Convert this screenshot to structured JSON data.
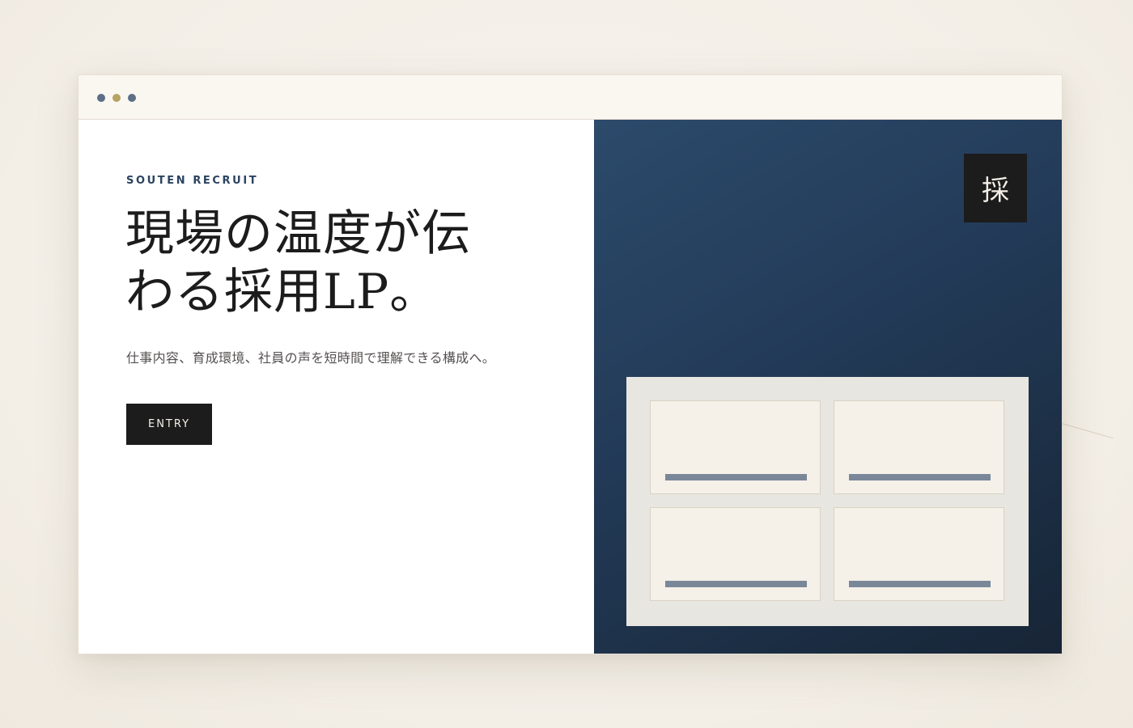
{
  "window": {
    "dots": [
      {
        "color": "#5c6f86"
      },
      {
        "color": "#b6a462"
      },
      {
        "color": "#5c6f86"
      }
    ]
  },
  "hero": {
    "eyebrow": "SOUTEN RECRUIT",
    "headline_line1": "現場の温度が伝",
    "headline_line2": "わる採用LP。",
    "subcopy": "仕事内容、育成環境、社員の声を短時間で理解できる構成へ。",
    "entry_label": "ENTRY"
  },
  "visual": {
    "badge_char": "採"
  },
  "colors": {
    "navy": "#243d5a",
    "ink": "#1c1c1c",
    "cream": "#f5f0e8",
    "gold_dot": "#b6a462",
    "slate_dot": "#5c6f86"
  }
}
